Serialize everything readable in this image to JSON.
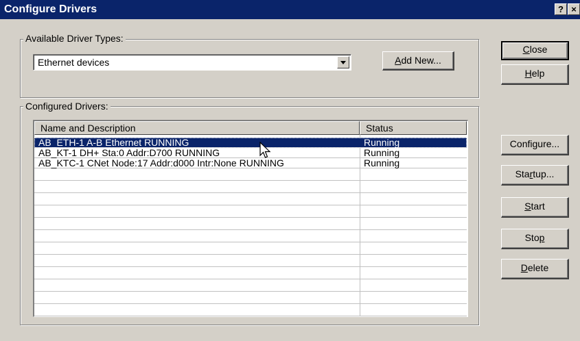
{
  "window": {
    "title": "Configure Drivers",
    "help_glyph": "?",
    "close_glyph": "×"
  },
  "available": {
    "legend": "Available Driver Types:",
    "selected": "Ethernet devices",
    "add_new": {
      "pre": "",
      "key": "A",
      "post": "dd New..."
    }
  },
  "buttons": {
    "close": {
      "pre": "",
      "key": "C",
      "post": "lose"
    },
    "help": {
      "pre": "",
      "key": "H",
      "post": "elp"
    },
    "configure": {
      "pre": "Confi",
      "key": "g",
      "post": "ure..."
    },
    "startup": {
      "pre": "Sta",
      "key": "r",
      "post": "tup..."
    },
    "start": {
      "pre": "",
      "key": "S",
      "post": "tart"
    },
    "stop": {
      "pre": "Sto",
      "key": "p",
      "post": ""
    },
    "delete": {
      "pre": "",
      "key": "D",
      "post": "elete"
    }
  },
  "configured": {
    "legend": "Configured Drivers:",
    "columns": [
      "Name and Description",
      "Status"
    ],
    "rows": [
      {
        "name": "AB_ETH-1  A-B Ethernet  RUNNING",
        "status": "Running",
        "selected": true
      },
      {
        "name": "AB_KT-1  DH+  Sta:0  Addr:D700  RUNNING",
        "status": "Running",
        "selected": false
      },
      {
        "name": "AB_KTC-1 CNet Node:17 Addr:d000 Intr:None RUNNING",
        "status": "Running",
        "selected": false
      }
    ]
  },
  "colors": {
    "titlebar": "#0a246a",
    "selection": "#0a246a",
    "face": "#d4d0c8"
  }
}
